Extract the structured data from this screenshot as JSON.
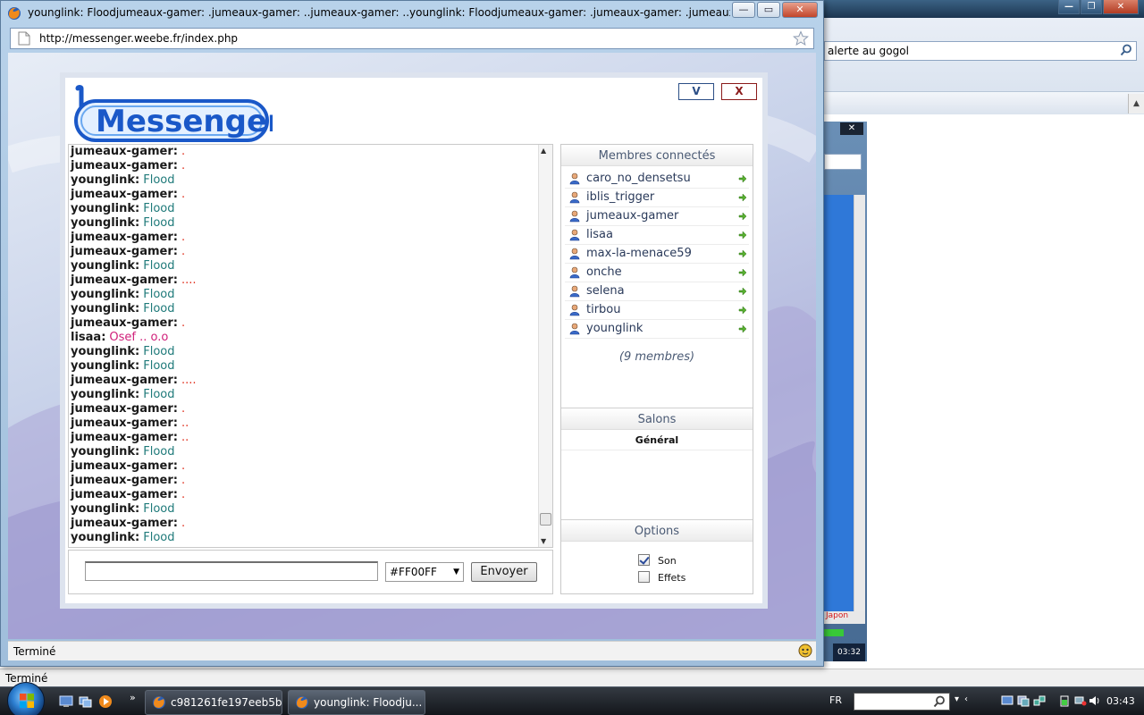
{
  "main_window": {
    "title": "younglink: Floodjumeaux-gamer: .jumeaux-gamer: ..jumeaux-gamer: ..younglink: Floodjumeaux-gamer: .jumeaux-gamer: .jumeaux-gamer: .younglink: Floodyounglink: Floodjumeaux-gamer: .",
    "url": "http://messenger.weebe.fr/index.php",
    "status": "Terminé",
    "icons": {
      "app": "firefox-icon",
      "page": "page-icon",
      "bookmark": "star-icon",
      "addon": "addon-face-icon"
    }
  },
  "background_window": {
    "search_value": "alerte au gogol",
    "status": "Terminé",
    "mini_window": {
      "label": "Japon",
      "time": "03:32"
    }
  },
  "messenger": {
    "logo_text": "Messenger",
    "btn_v": "V",
    "btn_x": "X",
    "messages": [
      {
        "author": "jumeaux-gamer:",
        "text": ".",
        "color": "#e0301e"
      },
      {
        "author": "jumeaux-gamer:",
        "text": ".",
        "color": "#e0301e"
      },
      {
        "author": "younglink:",
        "text": "Flood",
        "color": "#1f7a7a"
      },
      {
        "author": "jumeaux-gamer:",
        "text": ".",
        "color": "#e0301e"
      },
      {
        "author": "younglink:",
        "text": "Flood",
        "color": "#1f7a7a"
      },
      {
        "author": "younglink:",
        "text": "Flood",
        "color": "#1f7a7a"
      },
      {
        "author": "jumeaux-gamer:",
        "text": ".",
        "color": "#e0301e"
      },
      {
        "author": "jumeaux-gamer:",
        "text": ".",
        "color": "#e0301e"
      },
      {
        "author": "younglink:",
        "text": "Flood",
        "color": "#1f7a7a"
      },
      {
        "author": "jumeaux-gamer:",
        "text": "....",
        "color": "#e0301e"
      },
      {
        "author": "younglink:",
        "text": "Flood",
        "color": "#1f7a7a"
      },
      {
        "author": "younglink:",
        "text": "Flood",
        "color": "#1f7a7a"
      },
      {
        "author": "jumeaux-gamer:",
        "text": ".",
        "color": "#e0301e"
      },
      {
        "author": "lisaa:",
        "text": "Osef .. o.o",
        "color": "#d0207a"
      },
      {
        "author": "younglink:",
        "text": "Flood",
        "color": "#1f7a7a"
      },
      {
        "author": "younglink:",
        "text": "Flood",
        "color": "#1f7a7a"
      },
      {
        "author": "jumeaux-gamer:",
        "text": "....",
        "color": "#e0301e"
      },
      {
        "author": "younglink:",
        "text": "Flood",
        "color": "#1f7a7a"
      },
      {
        "author": "jumeaux-gamer:",
        "text": ".",
        "color": "#e0301e"
      },
      {
        "author": "jumeaux-gamer:",
        "text": "..",
        "color": "#e0301e"
      },
      {
        "author": "jumeaux-gamer:",
        "text": "..",
        "color": "#e0301e"
      },
      {
        "author": "younglink:",
        "text": "Flood",
        "color": "#1f7a7a"
      },
      {
        "author": "jumeaux-gamer:",
        "text": ".",
        "color": "#e0301e"
      },
      {
        "author": "jumeaux-gamer:",
        "text": ".",
        "color": "#e0301e"
      },
      {
        "author": "jumeaux-gamer:",
        "text": ".",
        "color": "#e0301e"
      },
      {
        "author": "younglink:",
        "text": "Flood",
        "color": "#1f7a7a"
      },
      {
        "author": "jumeaux-gamer:",
        "text": ".",
        "color": "#e0301e"
      },
      {
        "author": "younglink:",
        "text": "Flood",
        "color": "#1f7a7a"
      }
    ],
    "input": {
      "value": "",
      "color_value": "#FF00FF",
      "send_label": "Envoyer"
    },
    "members_title": "Membres connectés",
    "members": [
      "caro_no_densetsu",
      "iblis_trigger",
      "jumeaux-gamer",
      "lisaa",
      "max-la-menace59",
      "onche",
      "selena",
      "tirbou",
      "younglink"
    ],
    "members_count": "(9 membres)",
    "salons_title": "Salons",
    "salons": [
      "Général"
    ],
    "options_title": "Options",
    "options": [
      {
        "label": "Son",
        "checked": true
      },
      {
        "label": "Effets",
        "checked": false
      }
    ]
  },
  "taskbar": {
    "tasks": [
      {
        "label": "c981261fe197eeb5b...",
        "icon": "firefox-icon"
      },
      {
        "label": "younglink: Floodju...",
        "icon": "firefox-icon"
      }
    ],
    "language": "FR",
    "search_value": "",
    "clock": "03:43",
    "quicklaunch_more": "»"
  }
}
